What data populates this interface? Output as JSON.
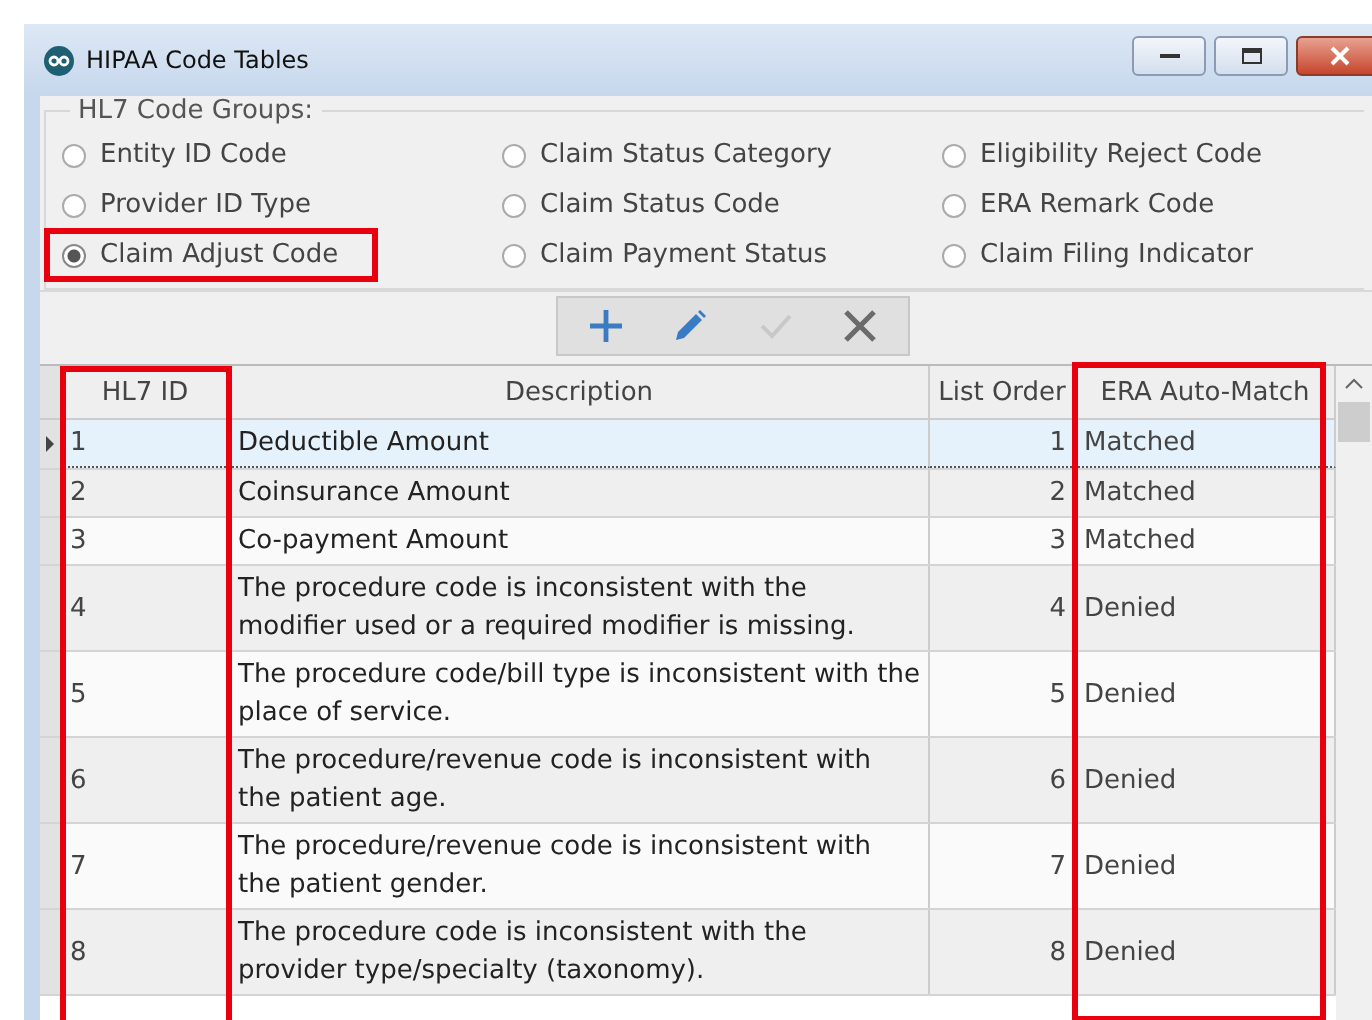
{
  "window": {
    "title": "HIPAA Code Tables"
  },
  "code_groups": {
    "label": "HL7 Code Groups:",
    "options": [
      {
        "label": "Entity ID Code",
        "selected": false
      },
      {
        "label": "Provider ID Type",
        "selected": false
      },
      {
        "label": "Claim Adjust Code",
        "selected": true
      },
      {
        "label": "Claim Status Category",
        "selected": false
      },
      {
        "label": "Claim Status Code",
        "selected": false
      },
      {
        "label": "Claim Payment Status",
        "selected": false
      },
      {
        "label": "Eligibility Reject Code",
        "selected": false
      },
      {
        "label": "ERA Remark Code",
        "selected": false
      },
      {
        "label": "Claim Filing Indicator",
        "selected": false
      }
    ]
  },
  "toolbar": [
    {
      "kind": "add",
      "disabled": false
    },
    {
      "kind": "edit",
      "disabled": false
    },
    {
      "kind": "save",
      "disabled": true
    },
    {
      "kind": "delete",
      "disabled": false
    }
  ],
  "table": {
    "columns": [
      "HL7 ID",
      "Description",
      "List Order",
      "ERA Auto-Match"
    ],
    "rows": [
      {
        "hl7_id": "1",
        "description": "Deductible Amount",
        "list_order": "1",
        "era_auto_match": "Matched",
        "selected": true
      },
      {
        "hl7_id": "2",
        "description": "Coinsurance Amount",
        "list_order": "2",
        "era_auto_match": "Matched",
        "selected": false
      },
      {
        "hl7_id": "3",
        "description": "Co-payment Amount",
        "list_order": "3",
        "era_auto_match": "Matched",
        "selected": false
      },
      {
        "hl7_id": "4",
        "description": "The procedure code is inconsistent with the modifier used or a required modifier is missing.",
        "list_order": "4",
        "era_auto_match": "Denied",
        "selected": false
      },
      {
        "hl7_id": "5",
        "description": "The procedure code/bill type is inconsistent with the place of service.",
        "list_order": "5",
        "era_auto_match": "Denied",
        "selected": false
      },
      {
        "hl7_id": "6",
        "description": "The procedure/revenue code is inconsistent with the patient age.",
        "list_order": "6",
        "era_auto_match": "Denied",
        "selected": false
      },
      {
        "hl7_id": "7",
        "description": "The procedure/revenue code is inconsistent with the patient gender.",
        "list_order": "7",
        "era_auto_match": "Denied",
        "selected": false
      },
      {
        "hl7_id": "8",
        "description": "The procedure code is inconsistent with the provider type/specialty (taxonomy).",
        "list_order": "8",
        "era_auto_match": "Denied",
        "selected": false
      }
    ]
  }
}
